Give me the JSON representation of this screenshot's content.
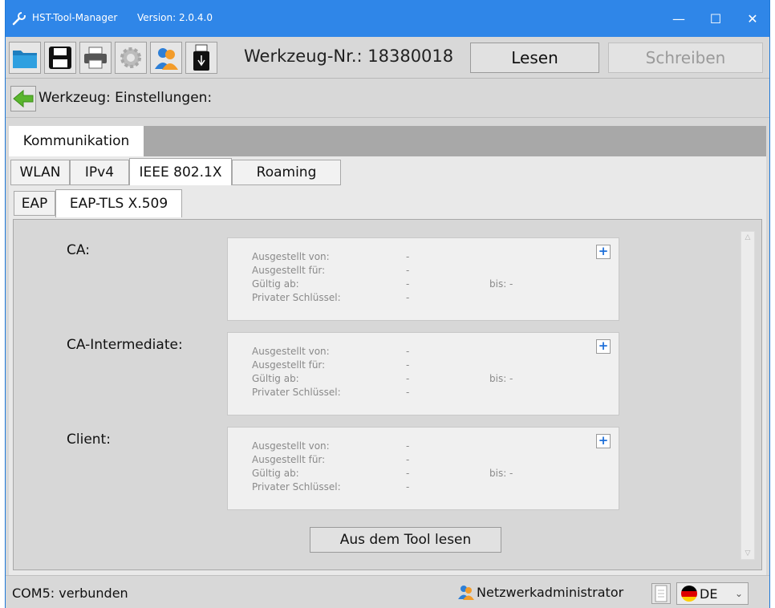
{
  "window": {
    "title": "HST-Tool-Manager",
    "version": "Version: 2.0.4.0",
    "minimize_glyph": "—",
    "maximize_glyph": "☐",
    "close_glyph": "✕",
    "accent_color": "#2f86e8"
  },
  "toolbar": {
    "icons": [
      "folder-icon",
      "save-icon",
      "print-icon",
      "settings-icon",
      "user-icon",
      "usb-icon"
    ],
    "tool_number": "Werkzeug-Nr.: 18380018",
    "read_label": "Lesen",
    "write_label": "Schreiben"
  },
  "nav": {
    "title": "Werkzeug: Einstellungen:"
  },
  "tabs": {
    "level1": [
      "Kommunikation"
    ],
    "level2": [
      "WLAN",
      "IPv4",
      "IEEE 802.1X",
      "Roaming"
    ],
    "level3": [
      "EAP",
      "EAP-TLS X.509"
    ]
  },
  "certs": [
    {
      "label": "CA:",
      "fields": {
        "issued_by": "Ausgestellt von:",
        "issued_for": "Ausgestellt für:",
        "valid_from": "Gültig ab:",
        "private_key": "Privater Schlüssel:"
      },
      "values": {
        "issued_by": "-",
        "issued_for": "-",
        "valid_from": "-",
        "private_key": "-",
        "until": "bis:  -"
      }
    },
    {
      "label": "CA-Intermediate:",
      "fields": {
        "issued_by": "Ausgestellt von:",
        "issued_for": "Ausgestellt für:",
        "valid_from": "Gültig ab:",
        "private_key": "Privater Schlüssel:"
      },
      "values": {
        "issued_by": "-",
        "issued_for": "-",
        "valid_from": "-",
        "private_key": "-",
        "until": "bis:  -"
      }
    },
    {
      "label": "Client:",
      "fields": {
        "issued_by": "Ausgestellt von:",
        "issued_for": "Ausgestellt für:",
        "valid_from": "Gültig ab:",
        "private_key": "Privater Schlüssel:"
      },
      "values": {
        "issued_by": "-",
        "issued_for": "-",
        "valid_from": "-",
        "private_key": "-",
        "until": "bis:  -"
      }
    }
  ],
  "add_glyph": "+",
  "read_from_tool_label": "Aus dem Tool lesen",
  "statusbar": {
    "connection": "COM5: verbunden",
    "user_role": "Netzwerkadministrator",
    "language": "DE"
  }
}
